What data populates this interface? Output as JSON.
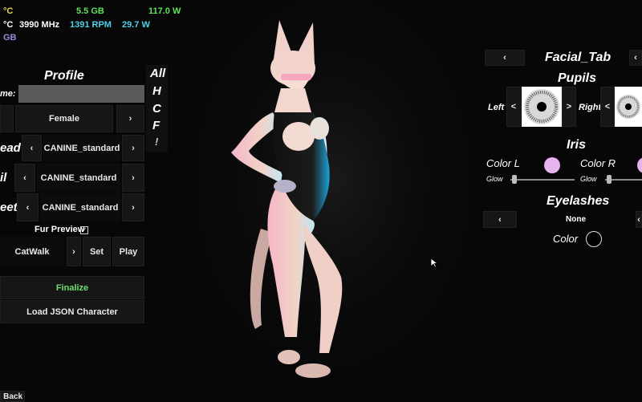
{
  "stats": {
    "cpu_temp_1": "°C",
    "ram": "5.5 GB",
    "power": "117.0 W",
    "cpu_temp_2": "°C",
    "clock": "3990 MHz",
    "fan": "1391 RPM",
    "power2": "29.7 W",
    "vram": "GB",
    "colors": {
      "temp": "#e6d84a",
      "green": "#5ee35a",
      "cyan": "#4ed0e6",
      "purple": "#9b8cd8"
    }
  },
  "left_panel": {
    "title": "Profile",
    "name_label": "me:",
    "name_value": "",
    "gender": {
      "value": "Female",
      "next": "›"
    },
    "head": {
      "label": "ead",
      "value": "CANINE_standard",
      "prev": "‹",
      "next": "›"
    },
    "tail": {
      "label": "il",
      "value": "CANINE_standard",
      "prev": "‹",
      "next": "›"
    },
    "feet": {
      "label": "eet",
      "value": "CANINE_standard",
      "prev": "‹",
      "next": "›"
    },
    "fur_preview": "Fur Preview",
    "fur_preview_checked": true,
    "animation": {
      "value": "CatWalk",
      "next": "›",
      "set": "Set",
      "play": "Play"
    },
    "finalize": "Finalize",
    "load_json": "Load JSON Character",
    "back": "Back"
  },
  "filter_tabs": [
    "All",
    "H",
    "C",
    "F",
    "!"
  ],
  "right_panel": {
    "tab_title": "Facial_Tab",
    "tab_prev": "‹",
    "tab_next": "‹",
    "pupils_title": "Pupils",
    "left_label": "Left",
    "right_label": "Right",
    "prev": "<",
    "next": ">",
    "iris_title": "Iris",
    "color_l": "Color L",
    "color_r": "Color R",
    "glow": "Glow",
    "iris_color": "#e6b3ef",
    "eyelashes_title": "Eyelashes",
    "eyelash_value": "None",
    "eyelash_prev": "‹",
    "eyelash_next": "‹",
    "color_label": "Color",
    "eyelash_color": "#000000"
  }
}
